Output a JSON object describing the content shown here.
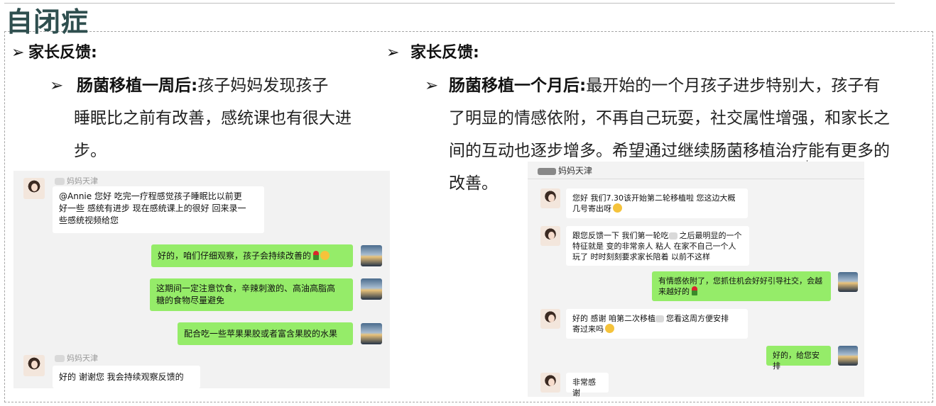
{
  "title": "自闭症",
  "left": {
    "heading": "家长反馈:",
    "label": "肠菌移植一周后",
    "colon": ":",
    "text_line1": "孩子妈妈发现孩子",
    "text_line2": "睡眠比之前有改善，感统课也有很大进",
    "text_line3": "步。",
    "chat": {
      "contact": "妈妈天津",
      "messages": [
        {
          "side": "in",
          "text_line1": "@Annie 您好  吃完一疗程感觉孩子睡眠比以前更",
          "text_line2": "好一些 感统有进步 现在感统课上的很好 回来录一",
          "text_line3": "些感统视频给您"
        },
        {
          "side": "out",
          "text": "好的，咱们仔细观察，孩子会持续改善的"
        },
        {
          "side": "out",
          "text_line1": "这期间一定注意饮食，辛辣刺激的、高油高脂高",
          "text_line2": "糖的食物尽量避免"
        },
        {
          "side": "out",
          "text": "配合吃一些苹果果胶或者富含果胶的水果"
        },
        {
          "side": "in",
          "text": "好的 谢谢您  我会持续观察反馈的"
        }
      ]
    }
  },
  "right": {
    "heading": "家长反馈:",
    "label": "肠菌移植一个月后",
    "colon": ":",
    "text_line1": "最开始的一个月孩子进步特别大，孩子有",
    "text_line2": "了明显的情感依附，不再自己玩耍，社交属性增强，和家长之",
    "text_line3": "间的互动也逐步增多。希望通过继续肠菌移植治疗能有更多的",
    "text_line4": "改善。",
    "chat": {
      "contact": "妈妈天津",
      "messages": [
        {
          "side": "in",
          "text_line1": "您好  我们7.30该开始第二轮移植啦  您这边大概",
          "text_line2": "几号寄出呀"
        },
        {
          "side": "in",
          "text_line1": "跟您反馈一下  我们第一轮吃",
          "text_line1b": "之后最明显的一个",
          "text_line2": "特征就是 变的非常亲人 粘人  在家不自己一个人",
          "text_line3": "玩了  时时刻刻要求家长陪着 以前不这样"
        },
        {
          "side": "out",
          "text_line1": "有情感依附了，您抓住机会好好引导社交，会越",
          "text_line2": "来越好的"
        },
        {
          "side": "in",
          "text_line1": "好的 感谢  咱第二次移植",
          "text_line1b": "您看这周方便安排",
          "text_line2": "寄过来吗"
        },
        {
          "side": "out",
          "text": "好的，给您安排"
        },
        {
          "side": "in",
          "text": "非常感谢"
        }
      ]
    }
  }
}
